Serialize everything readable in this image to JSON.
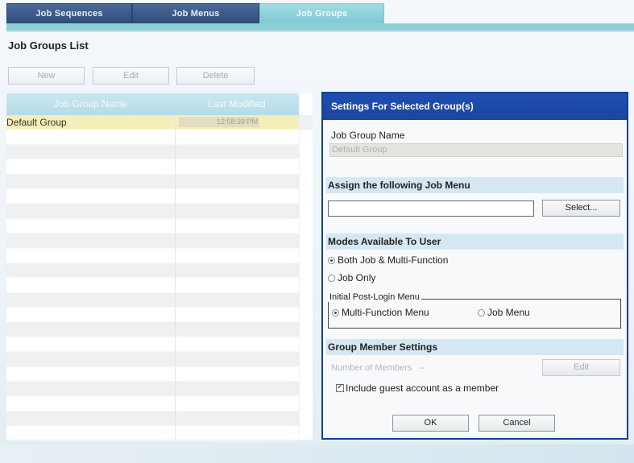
{
  "tabs": [
    {
      "label": "Job Sequences"
    },
    {
      "label": "Job Menus"
    },
    {
      "label": "Job Groups"
    }
  ],
  "page": {
    "title": "Job Groups List"
  },
  "toolbar": {
    "new_label": "New",
    "edit_label": "Edit",
    "delete_label": "Delete"
  },
  "list": {
    "headers": {
      "name": "Job Group Name",
      "modified": "Last Modified"
    },
    "rows": [
      {
        "name": "Default Group",
        "modified": "12:58:39 PM"
      }
    ]
  },
  "panel": {
    "title": "Settings For Selected Group(s)",
    "group_name_label": "Job Group Name",
    "group_name_value": "Default Group",
    "assign_section": "Assign the following Job Menu",
    "select_button": "Select...",
    "modes_section": "Modes Available To User",
    "mode_both": "Both Job & Multi-Function",
    "mode_job_only": "Job Only",
    "post_login_legend": "Initial Post-Login Menu",
    "post_login_multi": "Multi-Function Menu",
    "post_login_job": "Job Menu",
    "member_section": "Group Member Settings",
    "members_label": "Number of Members",
    "members_value": "--",
    "edit_button": "Edit",
    "include_guest": "Include guest account as a member",
    "ok_button": "OK",
    "cancel_button": "Cancel"
  },
  "colors": {
    "tab_active": "#8fd0d7",
    "tab_inactive": "#3a5886",
    "panel_border": "#123f96",
    "selected_row": "#f7edb8"
  }
}
